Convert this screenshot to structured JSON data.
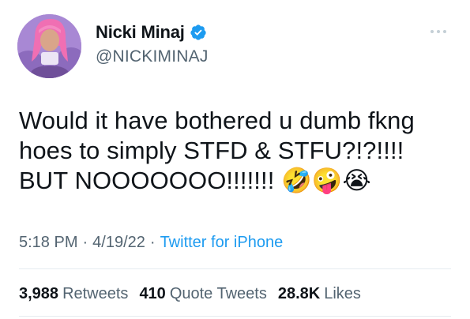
{
  "tweet": {
    "display_name": "Nicki Minaj",
    "handle": "@NICKIMINAJ",
    "verified": true,
    "text": "Would it have bothered u dumb fkng\nhoes to simply STFD & STFU?!?!!!!\nBUT NOOOOOOO!!!!!!! 🤣🤪😭",
    "time": "5:18 PM",
    "date": "4/19/22",
    "source": "Twitter for iPhone",
    "separator": "·"
  },
  "stats": {
    "retweets_count": "3,988",
    "retweets_label": "Retweets",
    "quote_count": "410",
    "quote_label": "Quote Tweets",
    "likes_count": "28.8K",
    "likes_label": "Likes"
  },
  "icons": {
    "verified": "verified-badge-icon",
    "more": "more-options-icon"
  },
  "colors": {
    "verified_blue": "#1d9bf0",
    "link_blue": "#1d9bf0",
    "secondary_text": "#536471",
    "primary_text": "#0f1419",
    "divider": "#e6ecf0",
    "avatar_bg": "#a17cc9",
    "avatar_hair": "#f06fb3"
  }
}
